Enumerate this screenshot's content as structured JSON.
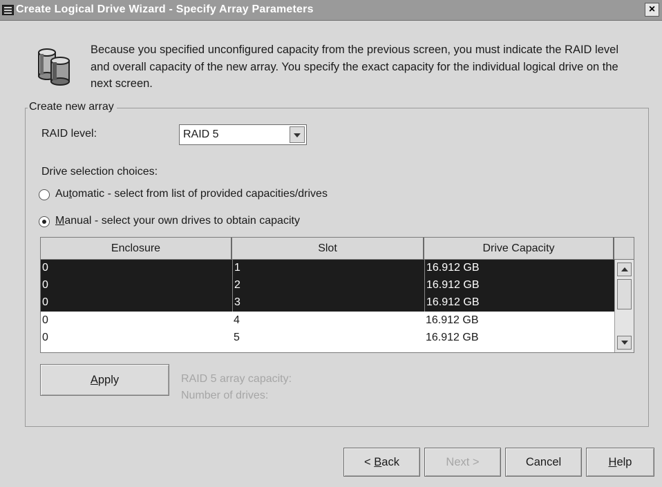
{
  "window": {
    "title": "Create Logical Drive Wizard - Specify Array Parameters",
    "close_glyph": "×"
  },
  "intro": {
    "text": "Because you specified unconfigured capacity from the previous screen, you must indicate the RAID level and overall capacity of the new array.  You specify the exact capacity for the individual logical drive on the next screen."
  },
  "group": {
    "legend": "Create new array"
  },
  "raid": {
    "label": "RAID level:",
    "selected": "RAID 5"
  },
  "drive_selection": {
    "label": "Drive selection choices:",
    "automatic": {
      "prefix": "Au",
      "mnemonic": "t",
      "rest": "omatic - select from list of provided capacities/drives",
      "checked": false
    },
    "manual": {
      "prefix": "",
      "mnemonic": "M",
      "rest": "anual - select your own drives to obtain capacity",
      "checked": true
    }
  },
  "table": {
    "columns": [
      "Enclosure",
      "Slot",
      "Drive Capacity"
    ],
    "rows": [
      {
        "enclosure": "0",
        "slot": "1",
        "capacity": "16.912 GB",
        "selected": true
      },
      {
        "enclosure": "0",
        "slot": "2",
        "capacity": "16.912 GB",
        "selected": true
      },
      {
        "enclosure": "0",
        "slot": "3",
        "capacity": "16.912 GB",
        "selected": true
      },
      {
        "enclosure": "0",
        "slot": "4",
        "capacity": "16.912 GB",
        "selected": false
      },
      {
        "enclosure": "0",
        "slot": "5",
        "capacity": "16.912 GB",
        "selected": false
      }
    ]
  },
  "apply": {
    "mnemonic": "A",
    "rest": "pply"
  },
  "summary": {
    "capacity_label": "RAID 5 array capacity:",
    "drives_label": "Number of drives:"
  },
  "buttons": {
    "back_prefix": "< ",
    "back_mnemonic": "B",
    "back_rest": "ack",
    "next": "Next >",
    "cancel": "Cancel",
    "help_mnemonic": "H",
    "help_rest": "elp"
  },
  "colors": {
    "selection": "#1c1c1c",
    "disabled_text": "#a6a6a6"
  }
}
